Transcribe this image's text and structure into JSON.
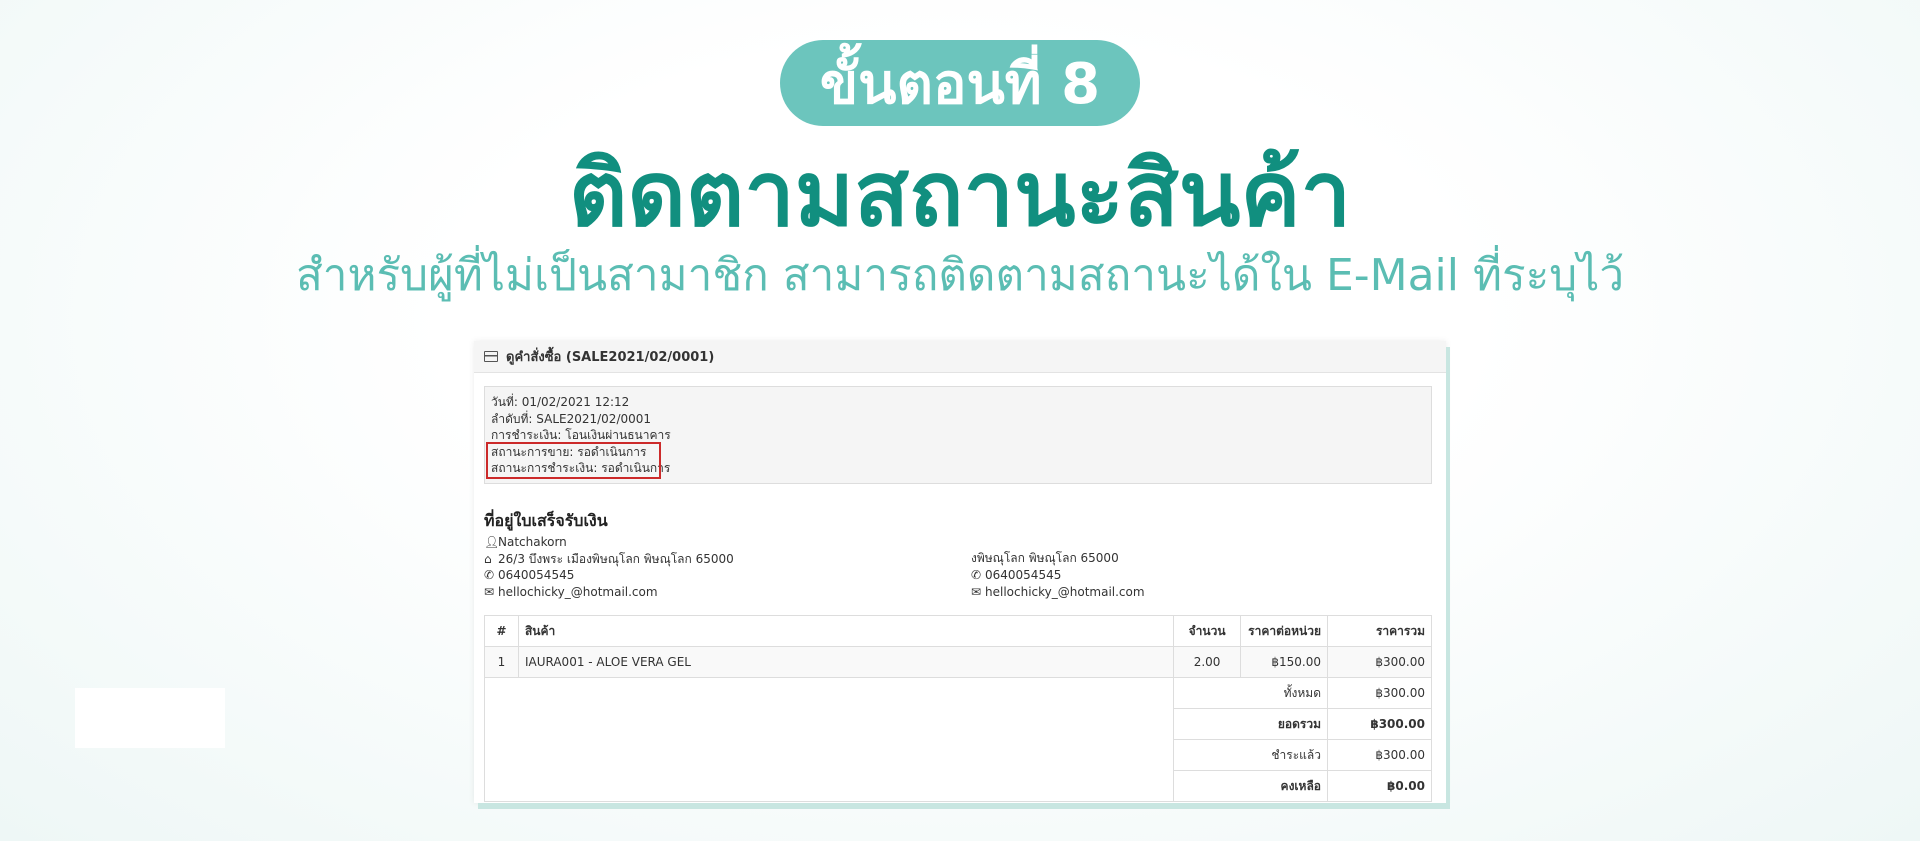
{
  "banner": {
    "step": "ขั้นตอนที่ 8",
    "title": "ติดตามสถานะสินค้า",
    "subtitle": "สำหรับผู้ที่ไม่เป็นสามาชิก สามารถติดตามสถานะได้ใน E-Mail ที่ระบุไว้"
  },
  "order": {
    "header_title": "ดูคำสั่งซื้อ (SALE2021/02/0001)",
    "date": "วันที่: 01/02/2021 12:12",
    "order_no": "ลำดับที่: SALE2021/02/0001",
    "payment": "การชำระเงิน: โอนเงินผ่านธนาคาร",
    "sale_status": "สถานะการขาย: รอดำเนินการ",
    "payment_status": "สถานะการชำระเงิน: รอดำเนินการ",
    "billing_title": "ที่อยู่ใบเสร็จรับเงิน",
    "billing": {
      "name": "Natchakorn",
      "address": "26/3 บึงพระ เมืองพิษณุโลก พิษณุโลก 65000",
      "phone": "0640054545",
      "email": "hellochicky_@hotmail.com"
    },
    "shipping": {
      "address": "งพิษณุโลก พิษณุโลก 65000",
      "phone": "0640054545",
      "email": "hellochicky_@hotmail.com"
    },
    "table": {
      "headers": [
        "#",
        "สินค้า",
        "จำนวน",
        "ราคาต่อหน่วย",
        "ราคารวม"
      ],
      "rows": [
        {
          "no": "1",
          "product": "IAURA001 - ALOE VERA GEL",
          "qty": "2.00",
          "unit": "฿150.00",
          "total": "฿300.00"
        }
      ],
      "summary": [
        {
          "label": "ทั้งหมด",
          "value": "฿300.00",
          "bold": false
        },
        {
          "label": "ยอดรวม",
          "value": "฿300.00",
          "bold": true
        },
        {
          "label": "ชำระแล้ว",
          "value": "฿300.00",
          "bold": false
        },
        {
          "label": "คงเหลือ",
          "value": "฿0.00",
          "bold": true
        }
      ]
    }
  }
}
